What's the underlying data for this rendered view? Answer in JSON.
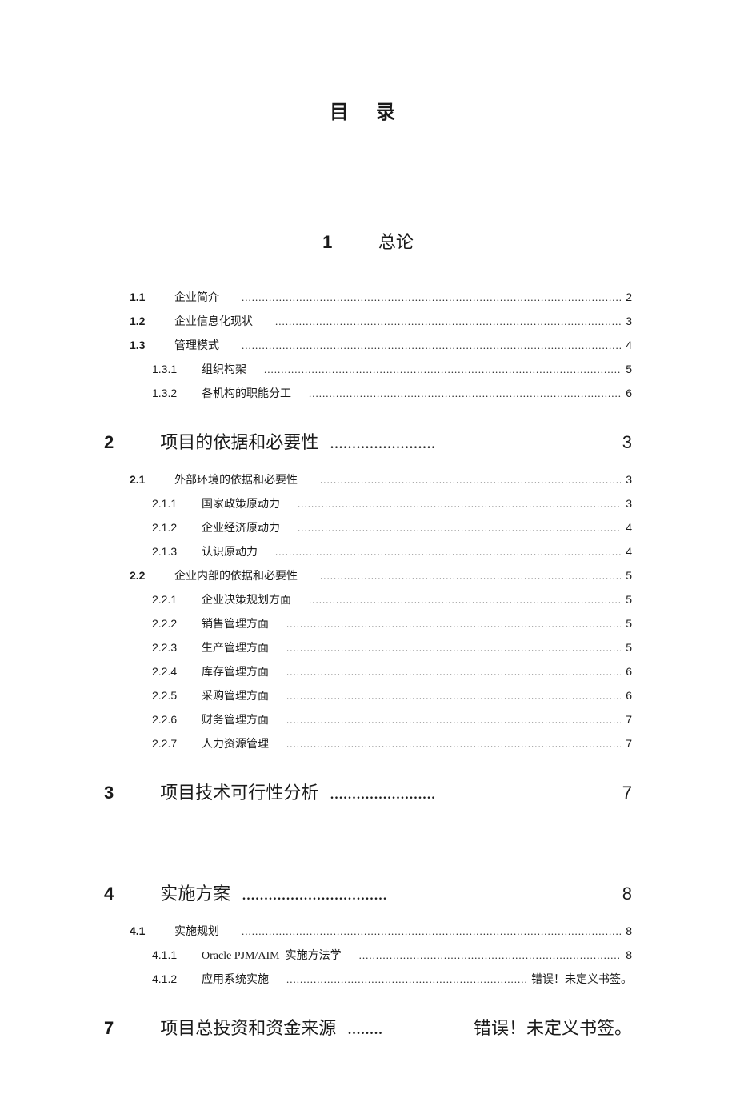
{
  "title": "目  录",
  "sections": [
    {
      "num": "1",
      "title": "总论",
      "page": ""
    },
    {
      "num": "2",
      "title": "项目的依据和必要性",
      "dots": "........................",
      "page": "3"
    },
    {
      "num": "3",
      "title": "项目技术可行性分析",
      "dots": "........................",
      "page": "7"
    },
    {
      "num": "4",
      "title": "实施方案",
      "dots": ".................................",
      "page": "8"
    },
    {
      "num": "7",
      "title": "项目总投资和资金来源",
      "dots": "........",
      "page": "错误！未定义书签。"
    }
  ],
  "toc": {
    "s1": [
      {
        "level": 1,
        "num": "1.1",
        "label": "企业简介",
        "page": "2"
      },
      {
        "level": 1,
        "num": "1.2",
        "label": "企业信息化现状",
        "page": "3"
      },
      {
        "level": 1,
        "num": "1.3",
        "label": "管理模式",
        "page": "4"
      },
      {
        "level": 2,
        "num": "1.3.1",
        "label": "组织构架",
        "page": "5"
      },
      {
        "level": 2,
        "num": "1.3.2",
        "label": "各机构的职能分工",
        "page": "6"
      }
    ],
    "s2": [
      {
        "level": 1,
        "num": "2.1",
        "label": "外部环境的依据和必要性",
        "page": "3"
      },
      {
        "level": 2,
        "num": "2.1.1",
        "label": "国家政策原动力",
        "page": "3"
      },
      {
        "level": 2,
        "num": "2.1.2",
        "label": "企业经济原动力",
        "page": "4"
      },
      {
        "level": 2,
        "num": "2.1.3",
        "label": "认识原动力",
        "page": "4"
      },
      {
        "level": 1,
        "num": "2.2",
        "label": "企业内部的依据和必要性",
        "page": "5"
      },
      {
        "level": 2,
        "num": "2.2.1",
        "label": "企业决策规划方面",
        "page": "5"
      },
      {
        "level": 2,
        "num": "2.2.2",
        "label": "销售管理方面",
        "page": "5"
      },
      {
        "level": 2,
        "num": "2.2.3",
        "label": "生产管理方面",
        "page": "5"
      },
      {
        "level": 2,
        "num": "2.2.4",
        "label": "库存管理方面",
        "page": "6"
      },
      {
        "level": 2,
        "num": "2.2.5",
        "label": "采购管理方面",
        "page": "6"
      },
      {
        "level": 2,
        "num": "2.2.6",
        "label": "财务管理方面",
        "page": "7"
      },
      {
        "level": 2,
        "num": "2.2.7",
        "label": "人力资源管理",
        "page": "7"
      }
    ],
    "s4": [
      {
        "level": 1,
        "num": "4.1",
        "label": "实施规划",
        "page": "8"
      },
      {
        "level": 2,
        "num": "4.1.1",
        "label": "Oracle PJM/AIM  实施方法学",
        "page": "8"
      },
      {
        "level": 2,
        "num": "4.1.2",
        "label": "应用系统实施",
        "page": "错误！未定义书签。"
      }
    ]
  },
  "leader": "............................................................................................................................................."
}
